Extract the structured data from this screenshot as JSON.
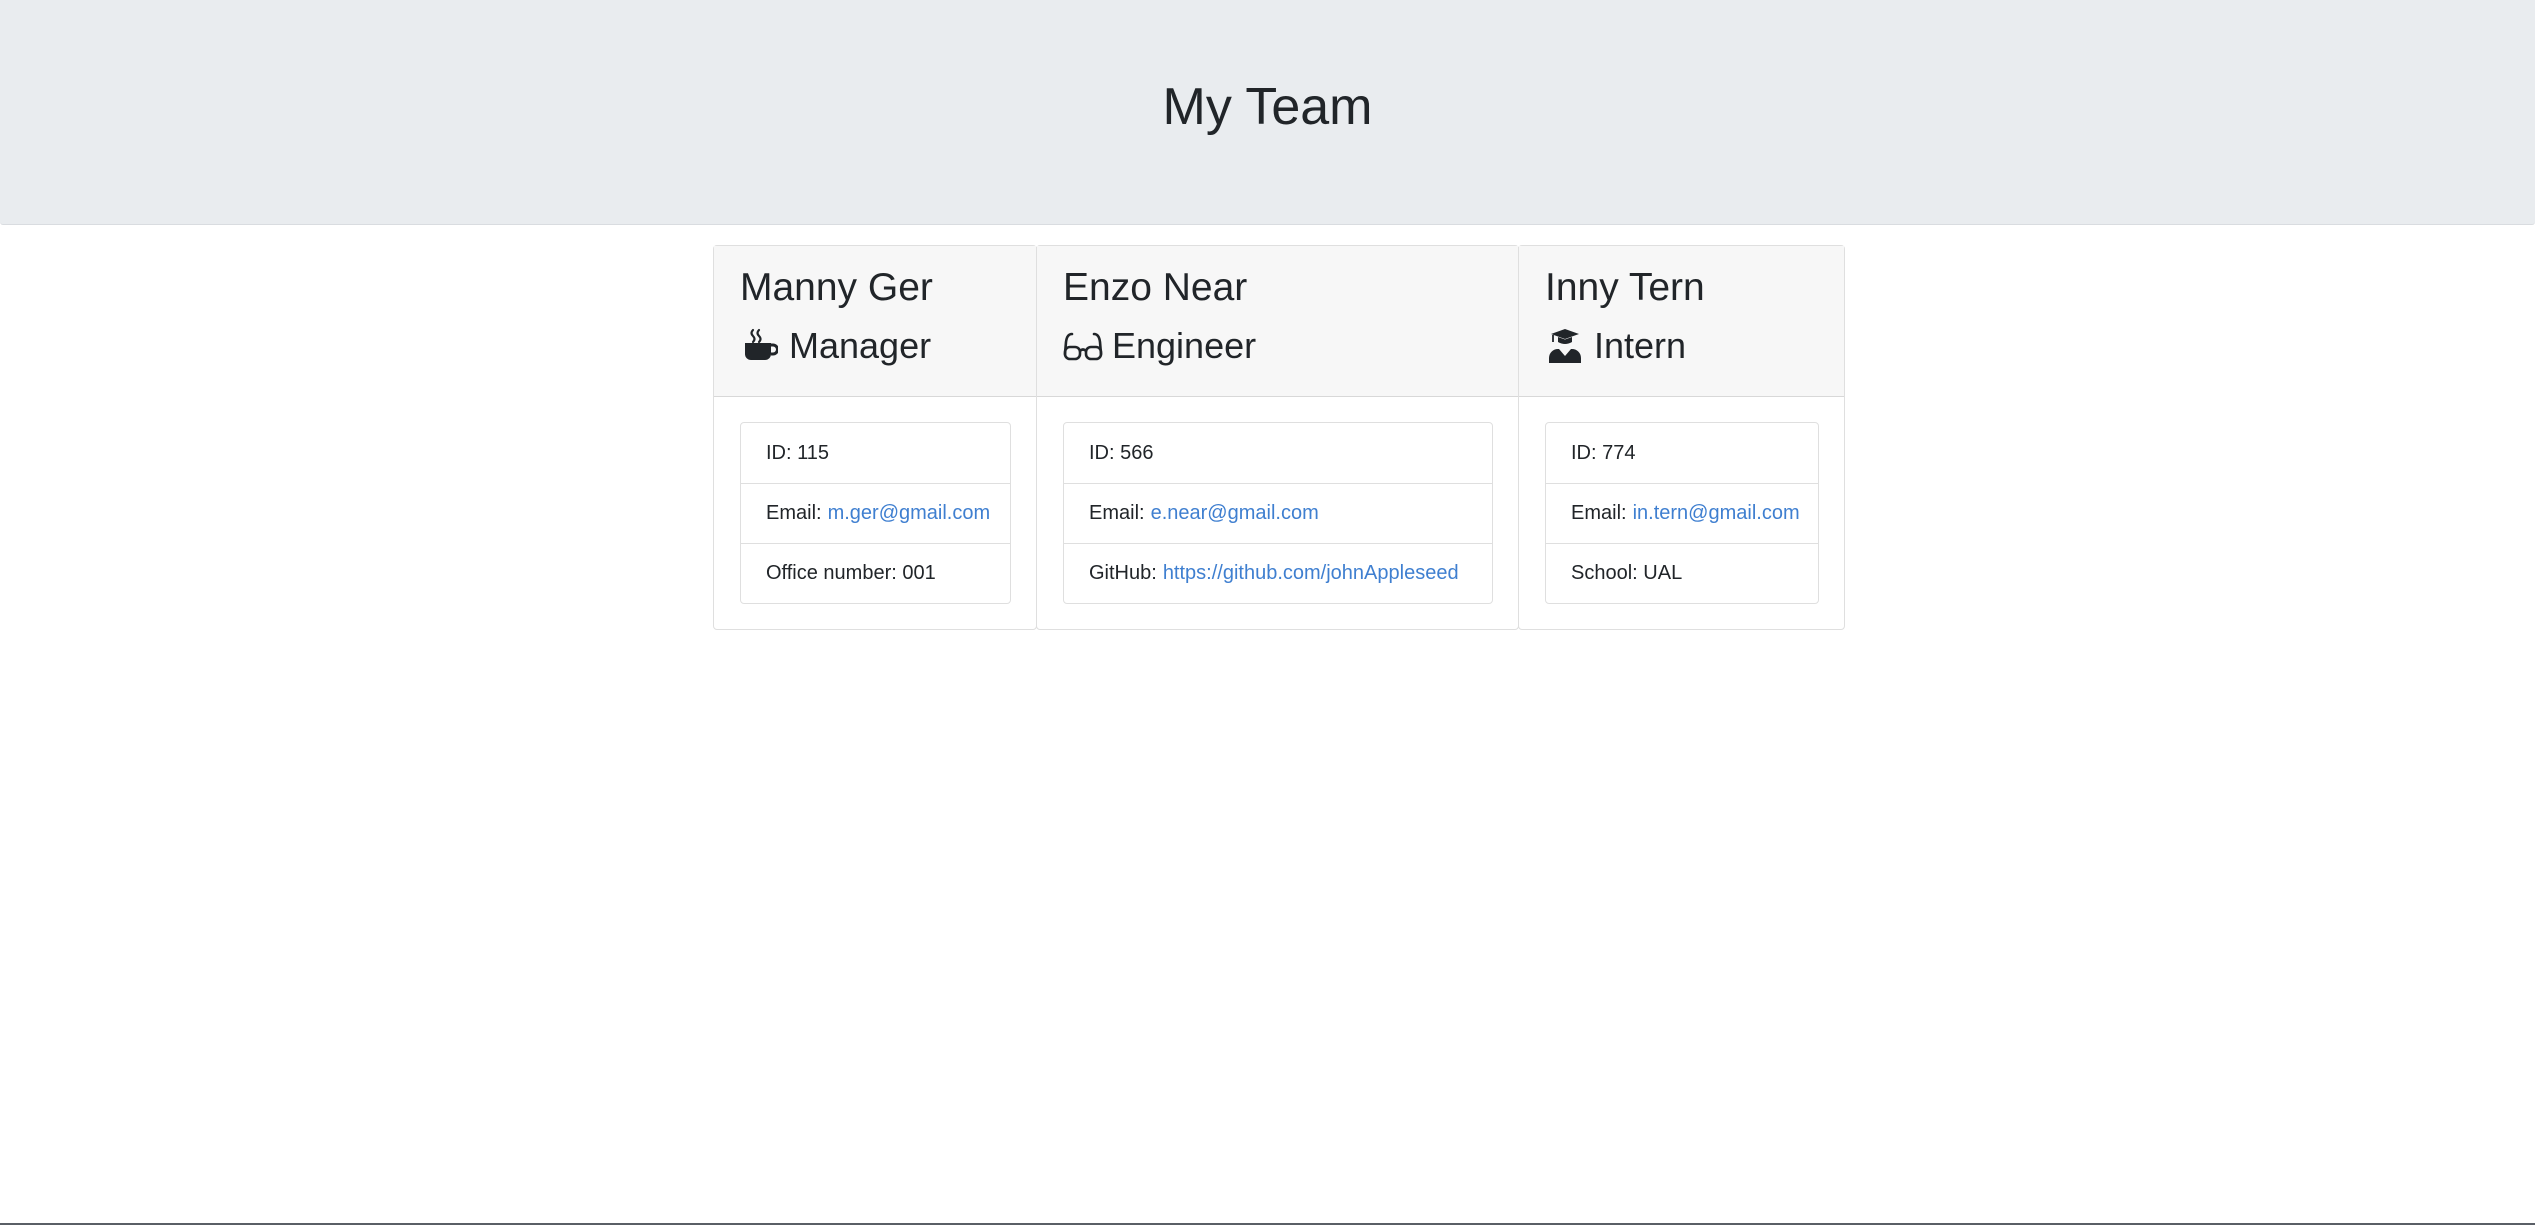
{
  "header": {
    "title": "My Team"
  },
  "team": [
    {
      "name": "Manny Ger",
      "role": "Manager",
      "icon": "coffee-icon",
      "id_label": "ID:",
      "id_value": "115",
      "email_label": "Email:",
      "email": "m.ger@gmail.com",
      "extra_label": "Office number:",
      "extra_value": "001"
    },
    {
      "name": "Enzo Near",
      "role": "Engineer",
      "icon": "glasses-icon",
      "id_label": "ID:",
      "id_value": "566",
      "email_label": "Email:",
      "email": "e.near@gmail.com",
      "extra_label": "GitHub:",
      "extra_value": "https://github.com/johnAppleseed"
    },
    {
      "name": "Inny Tern",
      "role": "Intern",
      "icon": "graduate-icon",
      "id_label": "ID:",
      "id_value": "774",
      "email_label": "Email:",
      "email": "in.tern@gmail.com",
      "extra_label": "School:",
      "extra_value": "UAL"
    }
  ],
  "colors": {
    "header_bg": "#e9ecef",
    "card_header_bg": "#f7f7f7",
    "link": "#3f7fd0",
    "text": "#212529"
  }
}
